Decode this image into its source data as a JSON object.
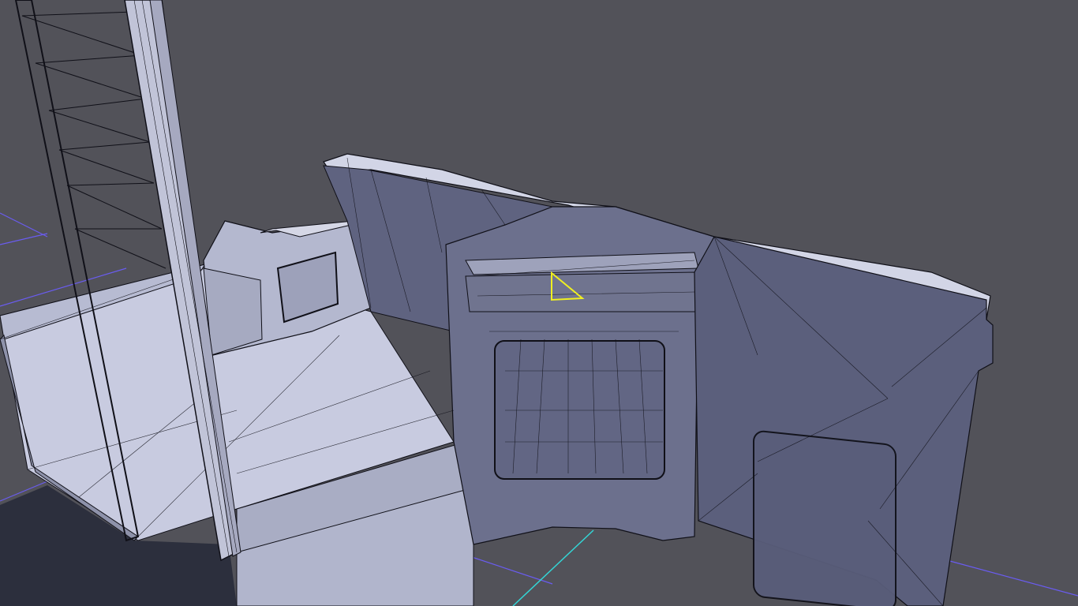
{
  "viewport": {
    "background_color": "#525259",
    "grid_color": "#6a5cf0",
    "axis_color": "#33d6d6",
    "mesh_light_color": "#c8cbe0",
    "mesh_mid_color": "#9a9db4",
    "mesh_dark_color": "#5b5f78",
    "wire_color": "#101018",
    "shadow_color": "#2c2f3d",
    "selection_color": "#f0f020",
    "selection": "selected-face-triangle"
  }
}
